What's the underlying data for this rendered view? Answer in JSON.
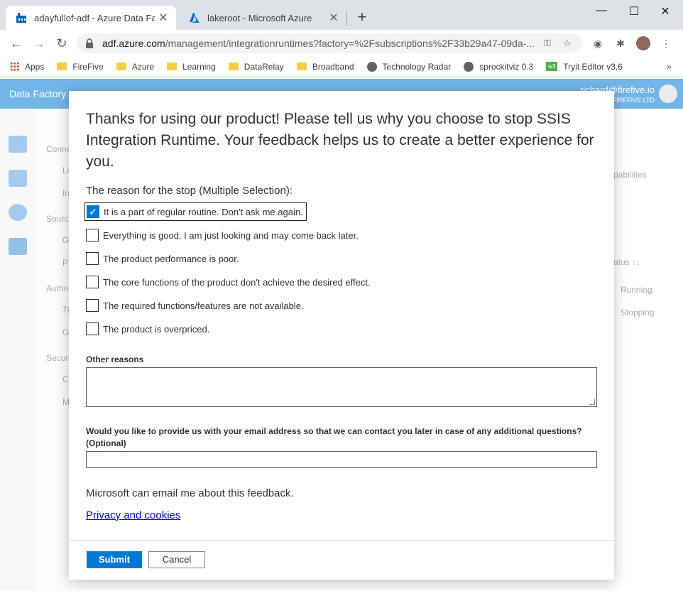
{
  "browser": {
    "tabs": [
      {
        "title": "adayfullof-adf - Azure Data Facto",
        "active": true
      },
      {
        "title": "lakeroot - Microsoft Azure",
        "active": false
      }
    ],
    "close_glyph": "✕",
    "new_tab_glyph": "+",
    "window_controls": [
      "—",
      "☐",
      "✕"
    ],
    "url_host": "adf.azure.com",
    "url_path": "/management/integrationruntimes?factory=%2Fsubscriptions%2F33b29a47-09da-...",
    "bookmarks": [
      {
        "label": "Apps",
        "icon": "apps-grid-icon"
      },
      {
        "label": "FireFive",
        "icon": "folder-icon"
      },
      {
        "label": "Azure",
        "icon": "folder-icon"
      },
      {
        "label": "Learning",
        "icon": "folder-icon"
      },
      {
        "label": "DataRelay",
        "icon": "folder-icon"
      },
      {
        "label": "Broadband",
        "icon": "folder-icon"
      },
      {
        "label": "Technology Radar",
        "icon": "globe-icon"
      },
      {
        "label": "sprockitviz 0.3",
        "icon": "globe-icon"
      },
      {
        "label": "Tryit Editor v3.6",
        "icon": "w3-icon"
      }
    ],
    "bookmarks_more": "»"
  },
  "app": {
    "brand": "Data Factory",
    "user_email": "richard@firefive.io",
    "user_org": "FIREFIVE LTD",
    "sidebar_fragments": [
      "Conne",
      "Li",
      "In",
      "Sourc",
      "G",
      "P",
      "Autho",
      "Tr",
      "G",
      "Securi",
      "C",
      "M"
    ],
    "right_fragments": {
      "capabilities": "pabilities",
      "status_header": "atus ↑↓",
      "row1_status": "Running",
      "row2_status": "Stopping"
    }
  },
  "dialog": {
    "title": "Thanks for using our product! Please tell us why you choose to stop SSIS Integration Runtime. Your feedback helps us to create a better experience for you.",
    "reason_heading": "The reason for the stop (Multiple Selection):",
    "reasons": [
      {
        "label": "It is a part of regular routine. Don't ask me again.",
        "checked": true
      },
      {
        "label": "Everything is good. I am just looking and may come back later.",
        "checked": false
      },
      {
        "label": "The product performance is poor.",
        "checked": false
      },
      {
        "label": "The core functions of the product don't achieve the desired effect.",
        "checked": false
      },
      {
        "label": "The required functions/features are not available.",
        "checked": false
      },
      {
        "label": "The product is overpriced.",
        "checked": false
      }
    ],
    "check_glyph": "✓",
    "other_reasons_label": "Other reasons",
    "other_reasons_value": "",
    "email_label": "Would you like to provide us with your email address so that we can contact you later in case of any additional questions? (Optional)",
    "email_value": "",
    "consent_text": "Microsoft can email me about this feedback.",
    "privacy_link": "Privacy and cookies",
    "submit_label": "Submit",
    "cancel_label": "Cancel"
  },
  "colors": {
    "accent": "#0078d4",
    "link": "#0000ee",
    "dialog_text": "#323130"
  }
}
